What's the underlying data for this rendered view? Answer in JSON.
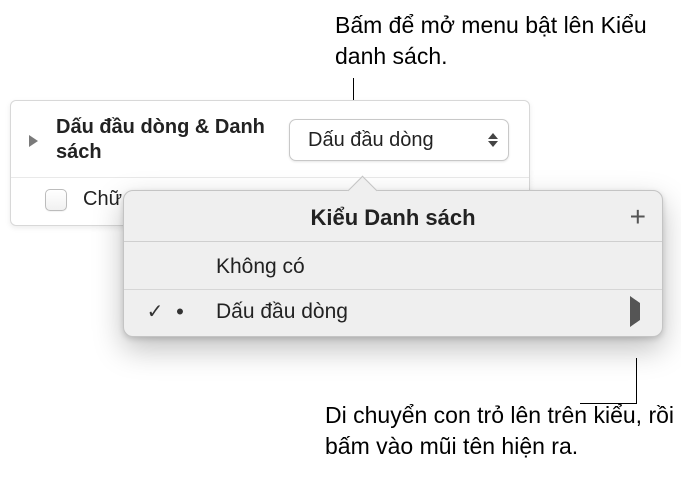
{
  "callouts": {
    "top": "Bấm để mở menu bật lên Kiểu danh sách.",
    "bottom": "Di chuyển con trỏ lên trên kiểu, rồi bấm vào mũi tên hiện ra."
  },
  "panel": {
    "section_label": "Dấu đầu dòng & Danh sách",
    "dropdown_value": "Dấu đầu dòng",
    "checkbox_label": "Chữ"
  },
  "popover": {
    "title": "Kiểu Danh sách",
    "items": [
      {
        "label": "Không có",
        "check": "",
        "bullet": ""
      },
      {
        "label": "Dấu đầu dòng",
        "check": "✓",
        "bullet": "•"
      }
    ]
  }
}
